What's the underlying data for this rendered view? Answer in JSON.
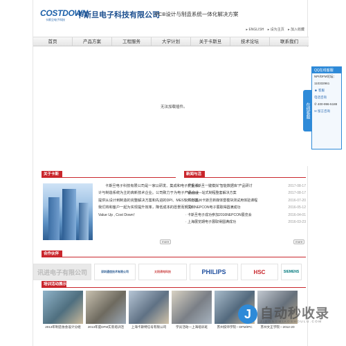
{
  "header": {
    "logo_word": "COSTDOWN",
    "logo_sub": "卡斯旦电子科技",
    "company": "卡斯旦电子科技有限公司",
    "slogan": "PCB设计与制造系统一体化解决方案",
    "links": [
      "▸ ENGLISH",
      "▸ 设为主页",
      "▸ 加入收藏"
    ]
  },
  "nav": {
    "items": [
      "首页",
      "产品方案",
      "工程服务",
      "大学计划",
      "关于卡斯旦",
      "技术论坛",
      "联系我们"
    ]
  },
  "banner": {
    "message": "无法加载插件。"
  },
  "about": {
    "heading": "关于卡斯旦",
    "text": "卡斯旦电子科技有限公司是一家以研发、集成和电子产品设计与制造系统为主的高新技术企业。公司致力于为电子产品企业提供从设计到制造的完整解决方案和先进的DPI、MES软件方案。我们将和客户一起为实现提升效率，降低成本的愿景而努力! Value Up , Cost Down！",
    "more": "more"
  },
  "news": {
    "heading": "新闻与活动",
    "more": "more",
    "items": [
      {
        "title": "· 祝贺卡斯旦一键模拟\"智能数据库\"产品研讨",
        "date": "2017-08-17"
      },
      {
        "title": "· Mentor—站式制程整套解决方案",
        "date": "2017-08-17"
      },
      {
        "title": "· 2016苏州卡斯旦新媒体暨模块测试用体验课程",
        "date": "2016-07-20"
      },
      {
        "title": "· 深圳NEPCON电子展取得圆满成功",
        "date": "2016-05-12"
      },
      {
        "title": "· 卡斯旦电子成功参加2016NEPCON展览会",
        "date": "2016-04-01"
      },
      {
        "title": "· 上海展览期电子展取得圆满成功",
        "date": "2016-03-23"
      }
    ]
  },
  "partners": {
    "heading": "合作伙伴",
    "items": [
      "讯进电子有限公司",
      "深圳通信技术有限公司",
      "太阳诱电科技",
      "PHILIPS",
      "HSC",
      "SIEMENS"
    ]
  },
  "training": {
    "heading": "培训活动展示",
    "items": [
      "2013年制造协会设计分组",
      "2013年度DFM实装培训活",
      "上海卡斯特信号有限公司",
      "学员活动—上海培训班",
      "苏州技师学院－DFM/IPC",
      "苏州文正学院－2012-20"
    ]
  },
  "qq": {
    "tab": "在线客服",
    "title": "QQ在线客服",
    "label": "NPI/DFM论坛：",
    "number": "110332961",
    "service": "客服",
    "phone_title": "电话咨询",
    "phone": "400-996-5188",
    "leave": "留言咨询"
  },
  "watermark": {
    "main": "自动秒收录",
    "sub": "ZIDONGMIAOSHOULU.COM",
    "icon": "J"
  },
  "colors": {
    "accent": "#c9262c",
    "brand": "#1c4f8f",
    "qq": "#2e8ad8"
  }
}
